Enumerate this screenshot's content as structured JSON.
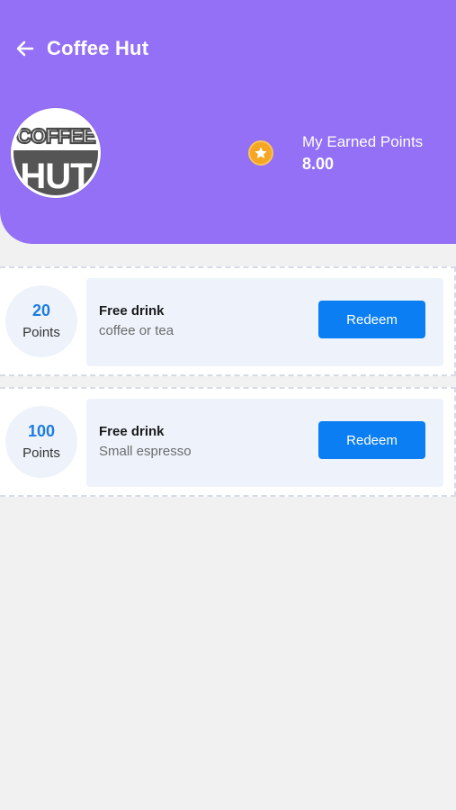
{
  "header": {
    "title": "Coffee Hut",
    "logo_text_line1": "COFFEE",
    "logo_text_line2": "HUT",
    "earned_points_label": "My Earned Points",
    "earned_points_value": "8.00",
    "accent_color": "#9370f5"
  },
  "rewards": [
    {
      "points": "20",
      "points_label": "Points",
      "title": "Free drink",
      "subtitle": "coffee or tea",
      "button_label": "Redeem"
    },
    {
      "points": "100",
      "points_label": "Points",
      "title": "Free drink",
      "subtitle": "Small espresso",
      "button_label": "Redeem"
    }
  ],
  "icons": {
    "back": "arrow-left-icon",
    "star": "star-icon"
  }
}
